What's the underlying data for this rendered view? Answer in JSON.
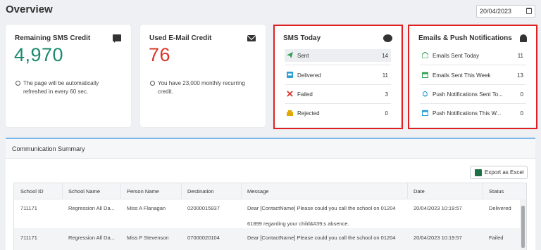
{
  "page": {
    "title": "Overview",
    "date": "20/04/2023"
  },
  "cards": {
    "sms_credit": {
      "title": "Remaining SMS Credit",
      "value": "4,970",
      "value_color": "#1a8a6e",
      "note": "The page will be automatically refreshed in every 60 sec.",
      "icon": "message-icon"
    },
    "email_credit": {
      "title": "Used E-Mail Credit",
      "value": "76",
      "value_color": "#d9362b",
      "note": "You have 23,000 monthly recurring credit.",
      "icon": "mail-icon"
    }
  },
  "sms_today": {
    "title": "SMS Today",
    "icon": "chat-bubble-icon",
    "rows": [
      {
        "label": "Sent",
        "value": "14",
        "icon": "paper-plane-icon",
        "color": "#2e9e4f"
      },
      {
        "label": "Delivered",
        "value": "11",
        "icon": "inbox-icon",
        "color": "#2a9fd6"
      },
      {
        "label": "Failed",
        "value": "3",
        "icon": "x-icon",
        "color": "#d9362b"
      },
      {
        "label": "Rejected",
        "value": "0",
        "icon": "stack-icon",
        "color": "#e0a800"
      }
    ]
  },
  "email_push": {
    "title": "Emails & Push Notifications",
    "icon": "bell-icon",
    "rows": [
      {
        "label": "Emails Sent Today",
        "value": "11",
        "icon": "envelope-open-icon",
        "color": "#2e9e4f"
      },
      {
        "label": "Emails Sent This Week",
        "value": "13",
        "icon": "calendar-icon",
        "color": "#2e9e4f"
      },
      {
        "label": "Push Notifications Sent To...",
        "value": "0",
        "icon": "bell-outline-icon",
        "color": "#2a9fd6"
      },
      {
        "label": "Push Notifications This W...",
        "value": "0",
        "icon": "calendar-icon",
        "color": "#2a9fd6"
      }
    ]
  },
  "summary": {
    "title": "Communication Summary",
    "export_label": "Export as Excel",
    "columns": [
      "School ID",
      "School Name",
      "Person Name",
      "Destination",
      "Message",
      "Date",
      "Status"
    ],
    "rows": [
      {
        "school_id": "711171",
        "school_name": "Regression All Da...",
        "person_name": "Miss A Flanagan",
        "destination": "02000015937",
        "message_line1": "Dear [ContactName] Please could you call the school on 01204",
        "message_line2": "61899 regarding your child&#39;s absence.",
        "date": "20/04/2023 10:19:57",
        "status": "Delivered"
      },
      {
        "school_id": "711171",
        "school_name": "Regression All Da...",
        "person_name": "Miss F Stevenson",
        "destination": "07000020104",
        "message_line1": "Dear [ContactName] Please could you call the school on 01204",
        "date": "20/04/2023 10:19:57",
        "status": "Failed"
      }
    ]
  }
}
